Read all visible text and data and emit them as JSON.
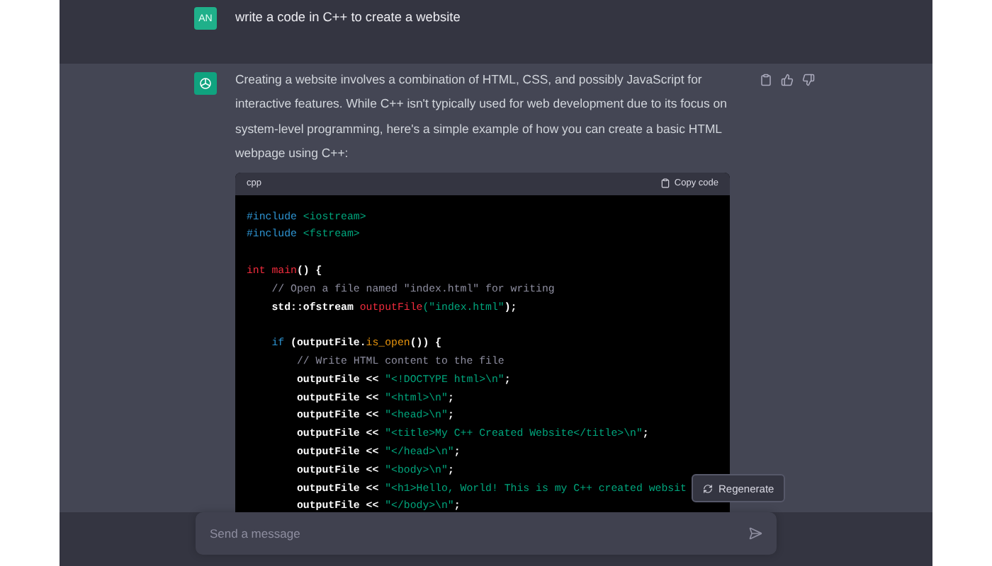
{
  "user_message": {
    "avatar": "AN",
    "text": "write a code in C++ to create a website"
  },
  "assistant_message": {
    "text": "Creating a website involves a combination of HTML, CSS, and possibly JavaScript for interactive features. While C++ isn't typically used for web development due to its focus on system-level programming, here's a simple example of how you can create a basic HTML webpage using C++:",
    "code": {
      "language": "cpp",
      "copy_label": "Copy code",
      "lines": [
        {
          "kind": "code",
          "tokens": [
            {
              "kind": "keyword",
              "text": "#include "
            },
            {
              "kind": "string",
              "text": "<iostream>"
            }
          ]
        },
        {
          "kind": "code",
          "tokens": [
            {
              "kind": "keyword",
              "text": "#include "
            },
            {
              "kind": "string",
              "text": "<fstream>"
            }
          ]
        },
        {
          "kind": "blank"
        },
        {
          "kind": "code",
          "tokens": [
            {
              "kind": "func",
              "text": "int main"
            },
            {
              "kind": "plain",
              "text": "() {"
            }
          ]
        },
        {
          "kind": "code",
          "tokens": [
            {
              "kind": "comment",
              "text": "    // Open a file named \"index.html\" for writing"
            }
          ]
        },
        {
          "kind": "code",
          "tokens": [
            {
              "kind": "plain",
              "text": "    std::ofstream "
            },
            {
              "kind": "func",
              "text": "outputFile"
            },
            {
              "kind": "string",
              "text": "(\"index.html\""
            },
            {
              "kind": "plain",
              "text": ");"
            }
          ]
        },
        {
          "kind": "blank"
        },
        {
          "kind": "code",
          "tokens": [
            {
              "kind": "keyword",
              "text": "    if"
            },
            {
              "kind": "plain",
              "text": " (outputFile."
            },
            {
              "kind": "method",
              "text": "is_open"
            },
            {
              "kind": "plain",
              "text": "()) {"
            }
          ]
        },
        {
          "kind": "code",
          "tokens": [
            {
              "kind": "comment",
              "text": "        // Write HTML content to the file"
            }
          ]
        },
        {
          "kind": "code",
          "tokens": [
            {
              "kind": "plain",
              "text": "        outputFile << "
            },
            {
              "kind": "string",
              "text": "\"<!DOCTYPE html>\\n\""
            },
            {
              "kind": "plain",
              "text": ";"
            }
          ]
        },
        {
          "kind": "code",
          "tokens": [
            {
              "kind": "plain",
              "text": "        outputFile << "
            },
            {
              "kind": "string",
              "text": "\"<html>\\n\""
            },
            {
              "kind": "plain",
              "text": ";"
            }
          ]
        },
        {
          "kind": "code",
          "tokens": [
            {
              "kind": "plain",
              "text": "        outputFile << "
            },
            {
              "kind": "string",
              "text": "\"<head>\\n\""
            },
            {
              "kind": "plain",
              "text": ";"
            }
          ]
        },
        {
          "kind": "code",
          "tokens": [
            {
              "kind": "plain",
              "text": "        outputFile << "
            },
            {
              "kind": "string",
              "text": "\"<title>My C++ Created Website</title>\\n\""
            },
            {
              "kind": "plain",
              "text": ";"
            }
          ]
        },
        {
          "kind": "code",
          "tokens": [
            {
              "kind": "plain",
              "text": "        outputFile << "
            },
            {
              "kind": "string",
              "text": "\"</head>\\n\""
            },
            {
              "kind": "plain",
              "text": ";"
            }
          ]
        },
        {
          "kind": "code",
          "tokens": [
            {
              "kind": "plain",
              "text": "        outputFile << "
            },
            {
              "kind": "string",
              "text": "\"<body>\\n\""
            },
            {
              "kind": "plain",
              "text": ";"
            }
          ]
        },
        {
          "kind": "code",
          "tokens": [
            {
              "kind": "plain",
              "text": "        outputFile << "
            },
            {
              "kind": "string",
              "text": "\"<h1>Hello, World! This is my C++ created websit"
            }
          ]
        },
        {
          "kind": "code",
          "tokens": [
            {
              "kind": "plain",
              "text": "        outputFile << "
            },
            {
              "kind": "string",
              "text": "\"</body>\\n\""
            },
            {
              "kind": "plain",
              "text": ";"
            }
          ]
        }
      ]
    }
  },
  "regenerate_button": {
    "label": "Regenerate"
  },
  "composer": {
    "placeholder": "Send a message"
  }
}
